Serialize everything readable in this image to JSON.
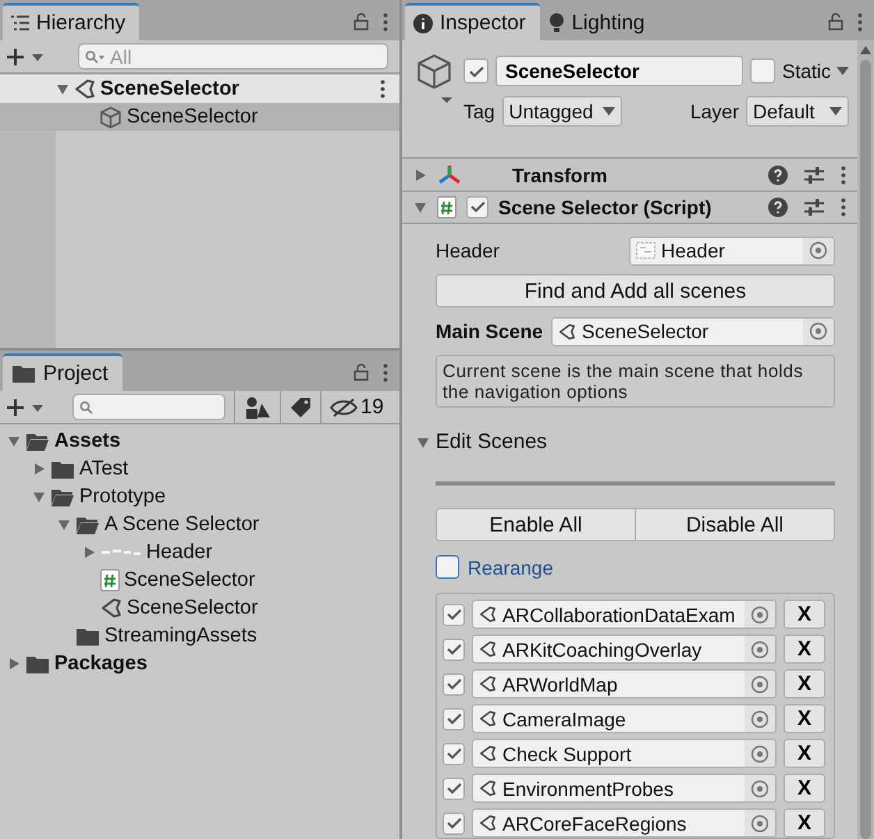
{
  "hierarchy": {
    "tab": "Hierarchy",
    "search": {
      "placeholder": "All"
    },
    "items": [
      {
        "label": "SceneSelector",
        "kind": "scene",
        "expanded": true,
        "selected": false,
        "children": [
          {
            "label": "SceneSelector",
            "kind": "object",
            "selected": true
          }
        ]
      }
    ]
  },
  "project": {
    "tab": "Project",
    "hidden_count": "19",
    "items": [
      {
        "label": "Assets",
        "kind": "folder",
        "root": true,
        "expanded": true,
        "children": [
          {
            "label": "ATest",
            "kind": "folder",
            "expanded": false
          },
          {
            "label": "Prototype",
            "kind": "folder",
            "expanded": true,
            "children": [
              {
                "label": "A Scene Selector",
                "kind": "folder",
                "expanded": true,
                "children": [
                  {
                    "label": "Header",
                    "kind": "texture",
                    "expanded": false
                  },
                  {
                    "label": "SceneSelector",
                    "kind": "script"
                  },
                  {
                    "label": "SceneSelector",
                    "kind": "scene"
                  }
                ]
              },
              {
                "label": "StreamingAssets",
                "kind": "folder"
              }
            ]
          }
        ]
      },
      {
        "label": "Packages",
        "kind": "folder",
        "root": true,
        "expanded": false
      }
    ]
  },
  "inspector": {
    "tabs": [
      {
        "label": "Inspector",
        "kind": "info",
        "selected": true
      },
      {
        "label": "Lighting",
        "kind": "bulb",
        "selected": false
      }
    ],
    "object": {
      "active": true,
      "name": "SceneSelector",
      "static_label": "Static",
      "static": false,
      "tag_label": "Tag",
      "tag": "Untagged",
      "layer_label": "Layer",
      "layer": "Default"
    },
    "components": [
      {
        "name": "Transform",
        "kind": "transform",
        "expanded": false
      },
      {
        "name": "Scene Selector (Script)",
        "kind": "script",
        "expanded": true,
        "enabled": true
      }
    ],
    "script": {
      "header_label": "Header",
      "header_value": "Header",
      "find_button": "Find and Add all scenes",
      "main_scene_label": "Main Scene",
      "main_scene_value": "SceneSelector",
      "help": "Current scene is the main scene that holds the navigation options",
      "edit_scenes": {
        "label": "Edit Scenes",
        "expanded": true
      },
      "enable_all": "Enable All",
      "disable_all": "Disable All",
      "rearrange": {
        "label": "Rearange",
        "checked": false
      },
      "scenes": [
        {
          "name": "ARCollaborationDataExam",
          "enabled": true,
          "remove": "X"
        },
        {
          "name": "ARKitCoachingOverlay",
          "enabled": true,
          "remove": "X"
        },
        {
          "name": "ARWorldMap",
          "enabled": true,
          "remove": "X"
        },
        {
          "name": "CameraImage",
          "enabled": true,
          "remove": "X"
        },
        {
          "name": "Check Support",
          "enabled": true,
          "remove": "X"
        },
        {
          "name": "EnvironmentProbes",
          "enabled": true,
          "remove": "X"
        },
        {
          "name": "ARCoreFaceRegions",
          "enabled": true,
          "remove": "X"
        }
      ]
    }
  }
}
